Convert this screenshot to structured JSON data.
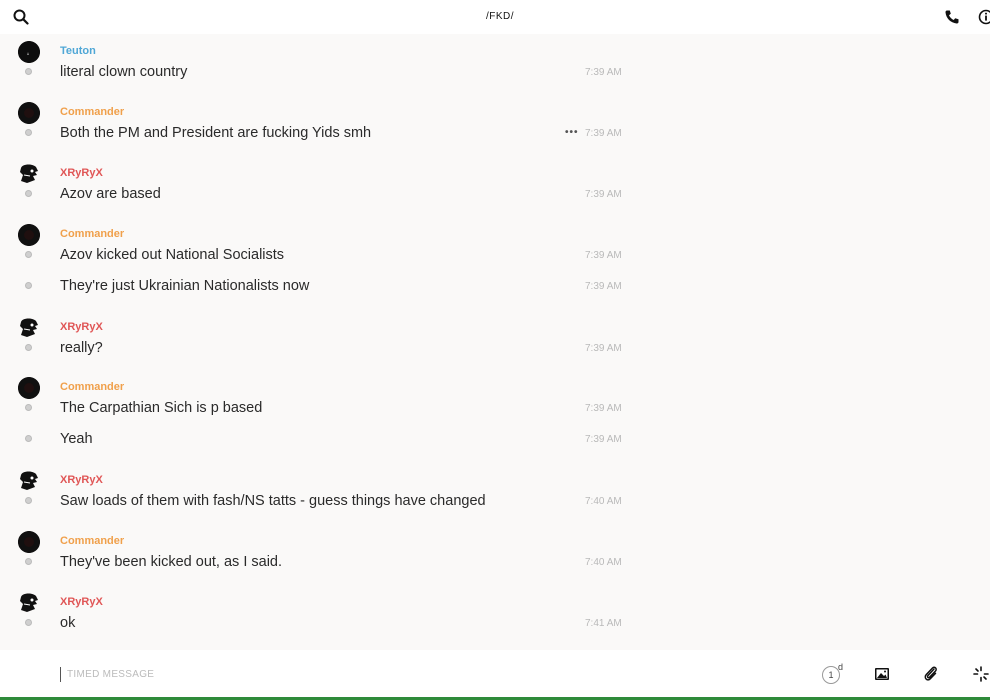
{
  "header": {
    "title": "/FKD/",
    "icons": [
      "search-icon",
      "phone-icon",
      "info-icon"
    ]
  },
  "colors": {
    "teuton": "#4fa7d6",
    "commander": "#f0a04b",
    "xryryx": "#e05656"
  },
  "messages": [
    {
      "sender": "Teuton",
      "text": "literal clown country",
      "time": "7:39 AM"
    },
    {
      "sender": "Commander",
      "text": "Both the PM and President are fucking Yids smh",
      "time": "7:39 AM",
      "more": "•••"
    },
    {
      "sender": "XRyRyX",
      "text": "Azov are based",
      "time": "7:39 AM"
    },
    {
      "sender": "Commander",
      "text": "Azov kicked out National Socialists",
      "time": "7:39 AM"
    },
    {
      "text": "They're just Ukrainian Nationalists now",
      "time": "7:39 AM"
    },
    {
      "sender": "XRyRyX",
      "text": "really?",
      "time": "7:39 AM"
    },
    {
      "sender": "Commander",
      "text": "The Carpathian Sich is p based",
      "time": "7:39 AM"
    },
    {
      "text": "Yeah",
      "time": "7:39 AM"
    },
    {
      "sender": "XRyRyX",
      "text": "Saw loads of them with fash/NS tatts - guess things have changed",
      "time": "7:40 AM"
    },
    {
      "sender": "Commander",
      "text": "They've been kicked out, as I said.",
      "time": "7:40 AM"
    },
    {
      "sender": "XRyRyX",
      "text": "ok",
      "time": "7:41 AM"
    }
  ],
  "composer": {
    "placeholder": "TIMED MESSAGE",
    "timer_value": "1",
    "timer_unit": "d"
  }
}
